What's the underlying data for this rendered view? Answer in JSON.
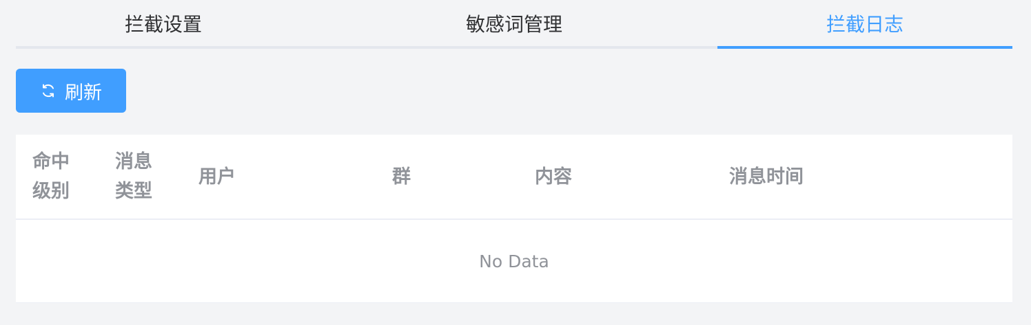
{
  "tabs": [
    {
      "label": "拦截设置",
      "active": false
    },
    {
      "label": "敏感词管理",
      "active": false
    },
    {
      "label": "拦截日志",
      "active": true
    }
  ],
  "colors": {
    "accent": "#409eff",
    "text": "#303133",
    "muted": "#909399",
    "background": "#f3f4f6"
  },
  "toolbar": {
    "refresh_label": "刷新",
    "refresh_icon": "refresh-icon"
  },
  "table": {
    "columns": [
      {
        "line1": "命中",
        "line2": "级别"
      },
      {
        "line1": "消息",
        "line2": "类型"
      },
      {
        "label": "用户"
      },
      {
        "label": "群"
      },
      {
        "label": "内容"
      },
      {
        "label": "消息时间"
      }
    ],
    "empty_text": "No Data"
  }
}
